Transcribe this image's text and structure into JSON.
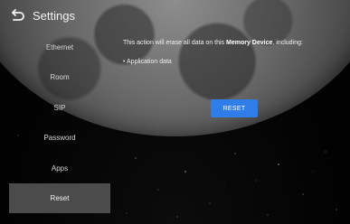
{
  "header": {
    "title": "Settings",
    "back_icon": "back-arrow-icon"
  },
  "sidebar": {
    "items": [
      {
        "label": "Ethernet"
      },
      {
        "label": "Room"
      },
      {
        "label": "SIP"
      },
      {
        "label": "Password"
      },
      {
        "label": "Apps"
      },
      {
        "label": "Reset"
      }
    ],
    "active": "Reset"
  },
  "main": {
    "message_prefix": "This action will erase all data on this ",
    "message_emphasis": "Memory Device",
    "message_suffix": ", including:",
    "bullet": "• Application data",
    "reset_label": "RESET"
  },
  "colors": {
    "accent": "#2f7de8",
    "active_bg": "#585858",
    "background": "#050505"
  }
}
